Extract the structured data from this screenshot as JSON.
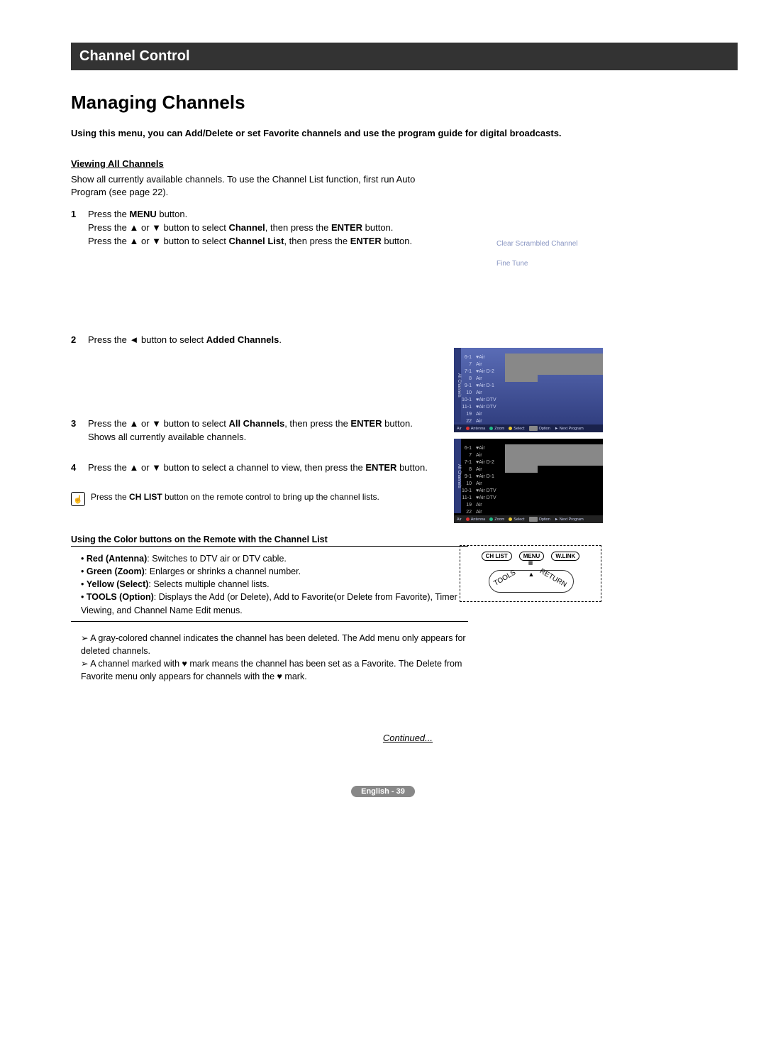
{
  "header": {
    "title": "Channel Control"
  },
  "main": {
    "title": "Managing Channels",
    "intro": "Using this menu, you can Add/Delete or set Favorite channels and use the program guide for digital broadcasts.",
    "viewing": {
      "heading": "Viewing All Channels",
      "body": "Show all currently available channels. To use the Channel List function, first run Auto Program (see page 22)."
    },
    "steps": {
      "s1": {
        "no": "1",
        "l1_a": "Press the ",
        "l1_b": "MENU",
        "l1_c": " button.",
        "l2_a": "Press the ▲ or ▼ button to select ",
        "l2_b": "Channel",
        "l2_c": ", then press the ",
        "l2_d": "ENTER",
        "l2_e": " button.",
        "l3_a": "Press the ▲ or ▼ button to select ",
        "l3_b": "Channel List",
        "l3_c": ", then press the ",
        "l3_d": "ENTER",
        "l3_e": " button."
      },
      "s2": {
        "no": "2",
        "a": "Press the ◄ button to select ",
        "b": "Added Channels",
        "c": "."
      },
      "s3": {
        "no": "3",
        "a": "Press the ▲ or ▼ button to select ",
        "b": "All Channels",
        "c": ", then press the ",
        "d": "ENTER",
        "e": " button.",
        "f": "Shows all currently available channels."
      },
      "s4": {
        "no": "4",
        "a": "Press the ▲ or ▼ button to select a channel to view, then press the ",
        "b": "ENTER",
        "c": " button."
      }
    },
    "tip": {
      "a": "Press the ",
      "b": "CH LIST",
      "c": " button on the remote control to bring up the channel lists."
    },
    "color": {
      "heading": "Using the Color buttons on the Remote with the Channel List",
      "items": [
        {
          "b": "Red (Antenna)",
          "t": ": Switches to DTV air or DTV cable."
        },
        {
          "b": "Green (Zoom)",
          "t": ": Enlarges or shrinks a channel number."
        },
        {
          "b": "Yellow (Select)",
          "t": ": Selects multiple channel lists."
        },
        {
          "b": "TOOLS (Option)",
          "t": ": Displays the Add (or Delete), Add to Favorite(or Delete from Favorite), Timer Viewing, and Channel Name Edit menus."
        }
      ],
      "notes": [
        "A gray-colored channel indicates the channel has been deleted. The Add menu only appears for deleted channels.",
        "A channel marked with ♥ mark means the channel has been set as a Favorite. The Delete from Favorite menu only appears for channels with the ♥ mark."
      ]
    },
    "continued": "Continued...",
    "footer": "English - 39"
  },
  "right": {
    "clear": "Clear Scrambled Channel",
    "fine": "Fine Tune"
  },
  "tv": {
    "sidebar": "All Channels",
    "rows": [
      {
        "num": "6-1",
        "name": "♥Air"
      },
      {
        "num": "7",
        "name": "Air"
      },
      {
        "num": "7-1",
        "name": "♥Air D-2"
      },
      {
        "num": "8",
        "name": "Air"
      },
      {
        "num": "9-1",
        "name": "♥Air D-1"
      },
      {
        "num": "10",
        "name": "Air"
      },
      {
        "num": "10-1",
        "name": "♥Air DTV"
      },
      {
        "num": "11-1",
        "name": "♥Air DTV"
      },
      {
        "num": "19",
        "name": "Air"
      },
      {
        "num": "22",
        "name": "Air"
      }
    ],
    "foot": {
      "src": "Air",
      "antenna": "Antenna",
      "zoom": "Zoom",
      "select": "Select",
      "tools": "TOOLS",
      "option": "Option",
      "next": "► Next Program"
    }
  },
  "remote": {
    "chlist": "CH LIST",
    "menu": "MENU",
    "wlink": "W.LINK",
    "tools": "TOOLS",
    "ret": "RETURN"
  }
}
